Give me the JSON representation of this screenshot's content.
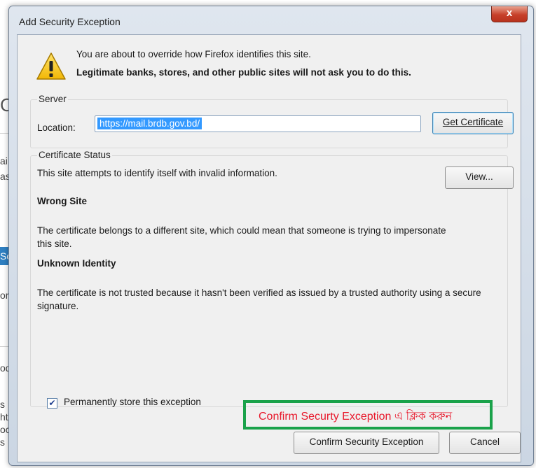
{
  "background_fragments": [
    "C",
    "ai",
    "as",
    "Sc",
    "or",
    "od",
    "s",
    "ht",
    "oc",
    "s"
  ],
  "dialog": {
    "title": "Add Security Exception",
    "close_glyph": "x",
    "warning_line1": "You are about to override how Firefox identifies this site.",
    "warning_line2": "Legitimate banks, stores, and other public sites will not ask you to do this.",
    "server": {
      "group_label": "Server",
      "location_label": "Location:",
      "location_value": "https://mail.brdb.gov.bd/",
      "get_certificate_button": "Get Certificate"
    },
    "certificate_status": {
      "group_label": "Certificate Status",
      "summary": "This site attempts to identify itself with invalid information.",
      "view_button": "View...",
      "wrong_site_heading": "Wrong Site",
      "wrong_site_text": "The certificate belongs to a different site, which could mean that someone is trying to impersonate this site.",
      "unknown_identity_heading": "Unknown Identity",
      "unknown_identity_text": "The certificate is not trusted because it hasn't been verified as issued by a trusted authority using a secure signature."
    },
    "permanent_checkbox": {
      "label": "Permanently store this exception",
      "checked": true
    },
    "confirm_button": "Confirm Security Exception",
    "cancel_button": "Cancel"
  },
  "annotation": {
    "text": "Confirm Securty Exception এ ক্লিক করুন",
    "border_color": "#1aa24a",
    "text_color": "#e8192c"
  },
  "icons": {
    "warning": "warning-triangle-icon",
    "checkbox_mark": "✔"
  }
}
